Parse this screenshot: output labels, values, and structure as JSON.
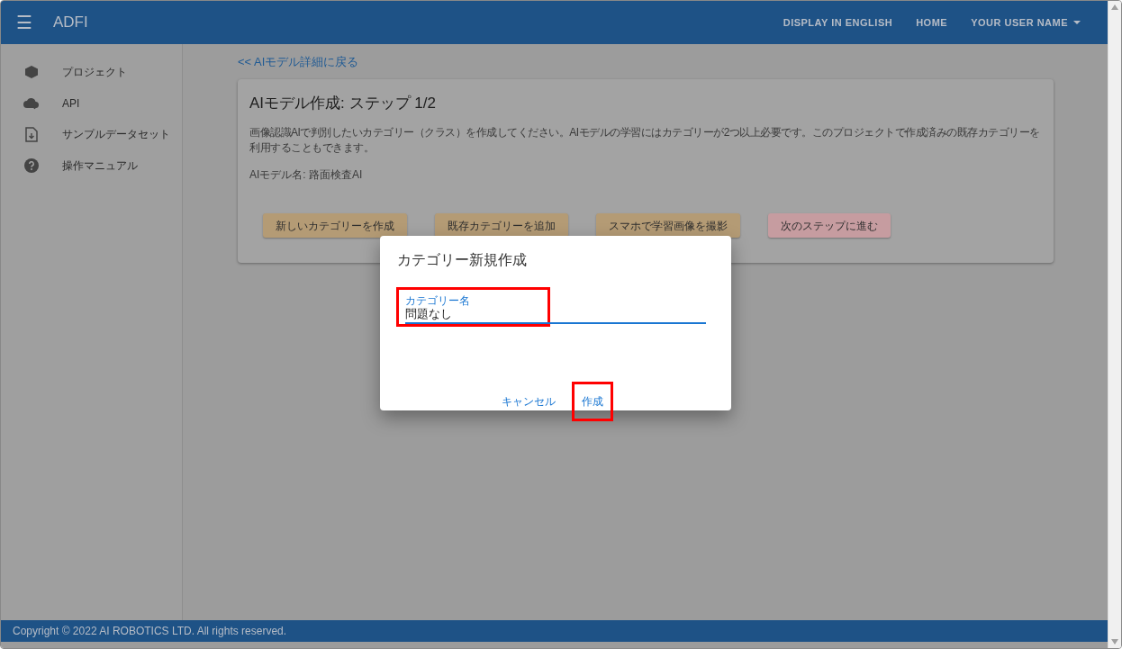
{
  "app_bar": {
    "menu_icon": "☰",
    "title": "ADFI",
    "actions": [
      {
        "label": "DISPLAY IN ENGLISH",
        "kind": "link"
      },
      {
        "label": "HOME",
        "kind": "link"
      },
      {
        "label": "YOUR USER NAME",
        "kind": "dropdown"
      }
    ]
  },
  "sidebar": {
    "items": [
      {
        "label": "プロジェクト",
        "kind": "cube"
      },
      {
        "label": "API",
        "kind": "cloud"
      },
      {
        "label": "サンプルデータセット",
        "kind": "file"
      },
      {
        "label": "操作マニュアル",
        "kind": "help"
      }
    ]
  },
  "back_link": "<< AIモデル詳細に戻る",
  "card": {
    "title": "AIモデル作成: ステップ 1/2",
    "description": "画像認識AIで判別したいカテゴリー（クラス）を作成してください。AIモデルの学習にはカテゴリーが2つ以上必要です。このプロジェクトで作成済みの既存カテゴリーを利用することもできます。",
    "model_name": "AIモデル名: 路面検査AI",
    "buttons": [
      {
        "label": "新しいカテゴリーを作成",
        "kind": "primary"
      },
      {
        "label": "既存カテゴリーを追加",
        "kind": "primary"
      },
      {
        "label": "スマホで学習画像を撮影",
        "kind": "primary"
      },
      {
        "label": "次のステップに進む",
        "kind": "secondary"
      }
    ]
  },
  "dialog": {
    "title": "カテゴリー新規作成",
    "field": {
      "label": "カテゴリー名",
      "value": "問題なし",
      "highlighted": true
    },
    "buttons": [
      {
        "label": "キャンセル",
        "highlighted": false
      },
      {
        "label": "作成",
        "highlighted": true
      }
    ]
  },
  "footer": "Copyright © 2022 AI ROBOTICS LTD. All rights reserved."
}
